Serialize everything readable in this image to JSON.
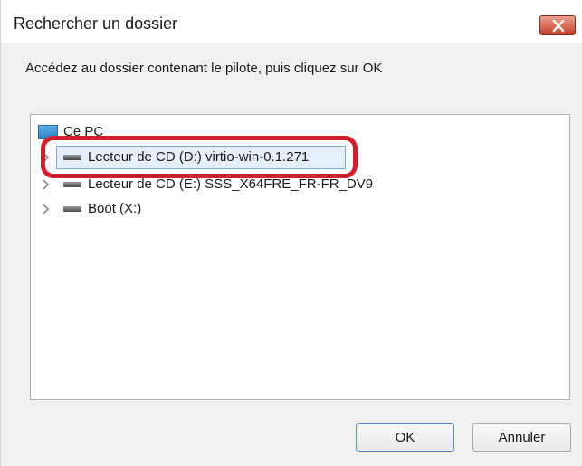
{
  "dialog": {
    "title": "Rechercher un dossier",
    "instruction": "Accédez au dossier contenant le pilote, puis cliquez sur OK"
  },
  "tree": {
    "root": {
      "label": "Ce PC",
      "icon": "computer-icon"
    },
    "items": [
      {
        "label": "Lecteur de CD (D:) virtio-win-0.1.271",
        "icon": "cd-drive-icon",
        "selected": true
      },
      {
        "label": "Lecteur de CD (E:) SSS_X64FRE_FR-FR_DV9",
        "icon": "cd-drive-icon",
        "selected": false
      },
      {
        "label": "Boot (X:)",
        "icon": "drive-icon",
        "selected": false
      }
    ]
  },
  "buttons": {
    "ok": "OK",
    "cancel": "Annuler"
  },
  "colors": {
    "highlight": "#d0202e",
    "selection": "#e6f0fb",
    "close": "#c8412f"
  }
}
